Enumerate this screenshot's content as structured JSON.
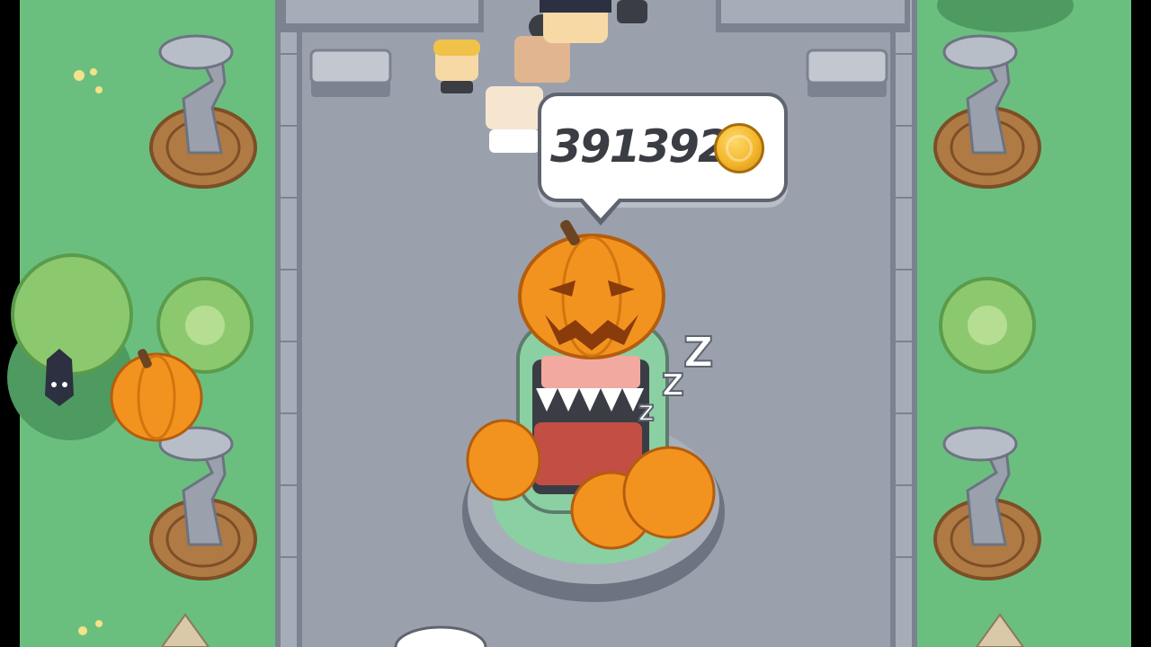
{
  "hud": {
    "coins": "391392",
    "coin_icon": "gold-coin-icon"
  },
  "colors": {
    "grass": "#6bbf7e",
    "path": "#9aa1ad",
    "wall": "#7b8290",
    "pumpkin": "#f3931f",
    "coin": "#f3b72c"
  },
  "icons": [
    "gold-coin-icon",
    "pumpkin-icon",
    "sleep-z-icon",
    "bat-icon"
  ]
}
